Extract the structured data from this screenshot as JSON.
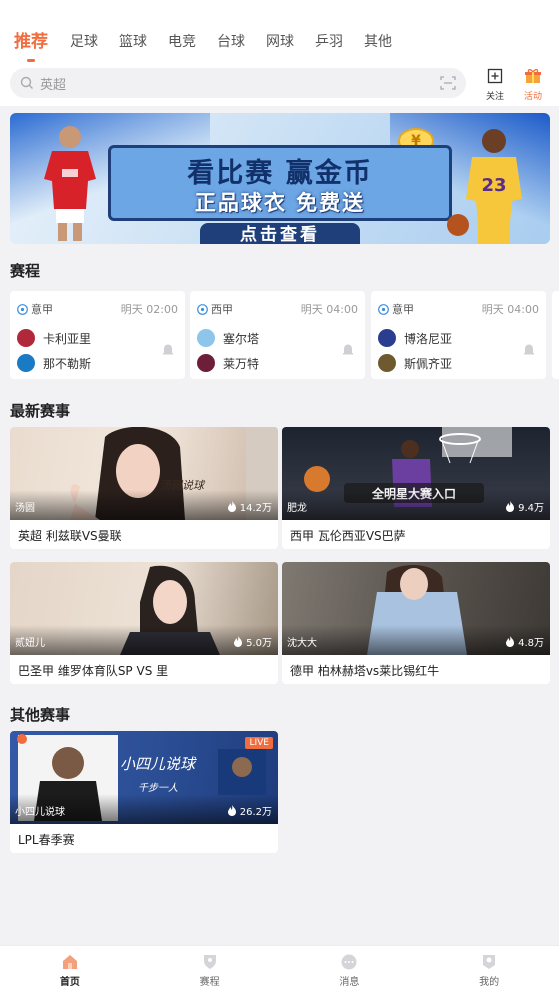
{
  "categories": [
    {
      "label": "推荐",
      "active": true
    },
    {
      "label": "足球"
    },
    {
      "label": "篮球"
    },
    {
      "label": "电竞"
    },
    {
      "label": "台球"
    },
    {
      "label": "网球"
    },
    {
      "label": "乒羽"
    },
    {
      "label": "其他"
    }
  ],
  "search": {
    "placeholder": "英超"
  },
  "actions": {
    "follow": "关注",
    "activity": "活动"
  },
  "banner": {
    "headline": "看比赛 赢金币",
    "subline": "正品球衣 免费送",
    "cta": "点击查看",
    "jersey_number": "23"
  },
  "sections": {
    "schedule": "赛程",
    "latest": "最新赛事",
    "other": "其他赛事"
  },
  "schedule": [
    {
      "league": "意甲",
      "time": "明天 02:00",
      "home": "卡利亚里",
      "away": "那不勒斯",
      "home_color": "#b0283a",
      "away_color": "#1b7ac4"
    },
    {
      "league": "西甲",
      "time": "明天 04:00",
      "home": "塞尔塔",
      "away": "莱万特",
      "home_color": "#8ec5ea",
      "away_color": "#6d1f3a"
    },
    {
      "league": "意甲",
      "time": "明天 04:00",
      "home": "博洛尼亚",
      "away": "斯佩齐亚",
      "home_color": "#2a3e8f",
      "away_color": "#6e5a2e"
    }
  ],
  "latest": [
    {
      "author": "汤圆",
      "views": "14.2万",
      "title": "英超 利兹联VS曼联",
      "caption": "汤圆说球"
    },
    {
      "author": "肥龙",
      "views": "9.4万",
      "title": "西甲 瓦伦西亚VS巴萨",
      "caption": "全明星大赛入口"
    },
    {
      "author": "贰妞儿",
      "views": "5.0万",
      "title": "巴圣甲 维罗体育队SP VS 里"
    },
    {
      "author": "沈大大",
      "views": "4.8万",
      "title": "德甲 柏林赫塔vs莱比锡红牛"
    }
  ],
  "other": [
    {
      "author": "小四儿说球",
      "views": "26.2万",
      "title": "LPL春季赛",
      "badge": "LIVE",
      "caption": "小四儿说球",
      "caption2": "千步一人"
    }
  ],
  "tabbar": [
    {
      "label": "首页",
      "active": true
    },
    {
      "label": "赛程"
    },
    {
      "label": "消息"
    },
    {
      "label": "我的"
    }
  ],
  "colors": {
    "accent": "#f26d3d",
    "background": "#f2f2f4"
  }
}
